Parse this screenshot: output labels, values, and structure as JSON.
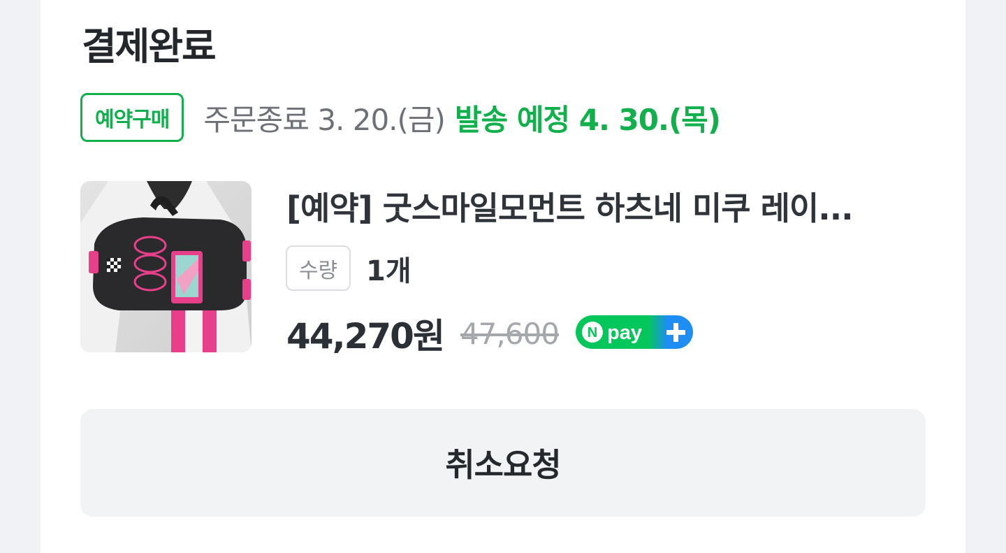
{
  "order": {
    "status_title": "결제완료",
    "preorder_badge": "예약구매",
    "order_end": "주문종료 3. 20.(금)",
    "ship_date": "발송 예정 4. 30.(목)"
  },
  "product": {
    "name": "[예약] 굿스마일모먼트 하츠네 미쿠 레이...",
    "quantity_label": "수량",
    "quantity_value": "1개",
    "price": "44,270원",
    "original_price": "47,600",
    "npay_badge_text": "pay",
    "npay_logo_letter": "N"
  },
  "actions": {
    "cancel_request": "취소요청"
  },
  "colors": {
    "accent_green": "#12b04c",
    "npay_gradient_start": "#03c75a",
    "npay_gradient_end": "#1e8ef5",
    "bag_pink": "#e83f8a",
    "bag_black": "#2a2a2c"
  },
  "icons": {
    "product_image": "duffel-bag-photo",
    "npay_plus": "plus-icon"
  }
}
